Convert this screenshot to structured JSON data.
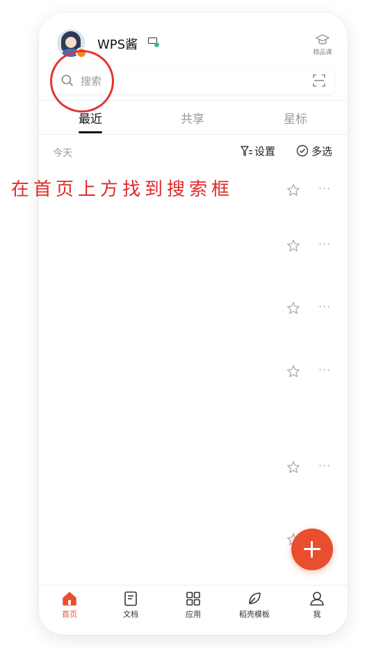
{
  "header": {
    "username": "WPS酱",
    "course_label": "精品课"
  },
  "search": {
    "placeholder": "搜索"
  },
  "tabs": [
    {
      "label": "最近",
      "active": true
    },
    {
      "label": "共享",
      "active": false
    },
    {
      "label": "星标",
      "active": false
    }
  ],
  "list": {
    "section_label": "今天",
    "settings_label": "设置",
    "multiselect_label": "多选",
    "more_glyph": "···"
  },
  "annotation": {
    "text": "在首页上方找到搜索框",
    "color": "#e02a2a"
  },
  "fab": {
    "icon": "plus-icon",
    "color": "#e94e2e"
  },
  "bottom_nav": [
    {
      "label": "首页",
      "icon": "home-icon",
      "active": true
    },
    {
      "label": "文档",
      "icon": "document-icon",
      "active": false
    },
    {
      "label": "应用",
      "icon": "apps-grid-icon",
      "active": false
    },
    {
      "label": "稻壳模板",
      "icon": "leaf-icon",
      "active": false
    },
    {
      "label": "我",
      "icon": "user-icon",
      "active": false
    }
  ],
  "colors": {
    "accent": "#e94e2e",
    "online_status": "#3cc07a"
  }
}
